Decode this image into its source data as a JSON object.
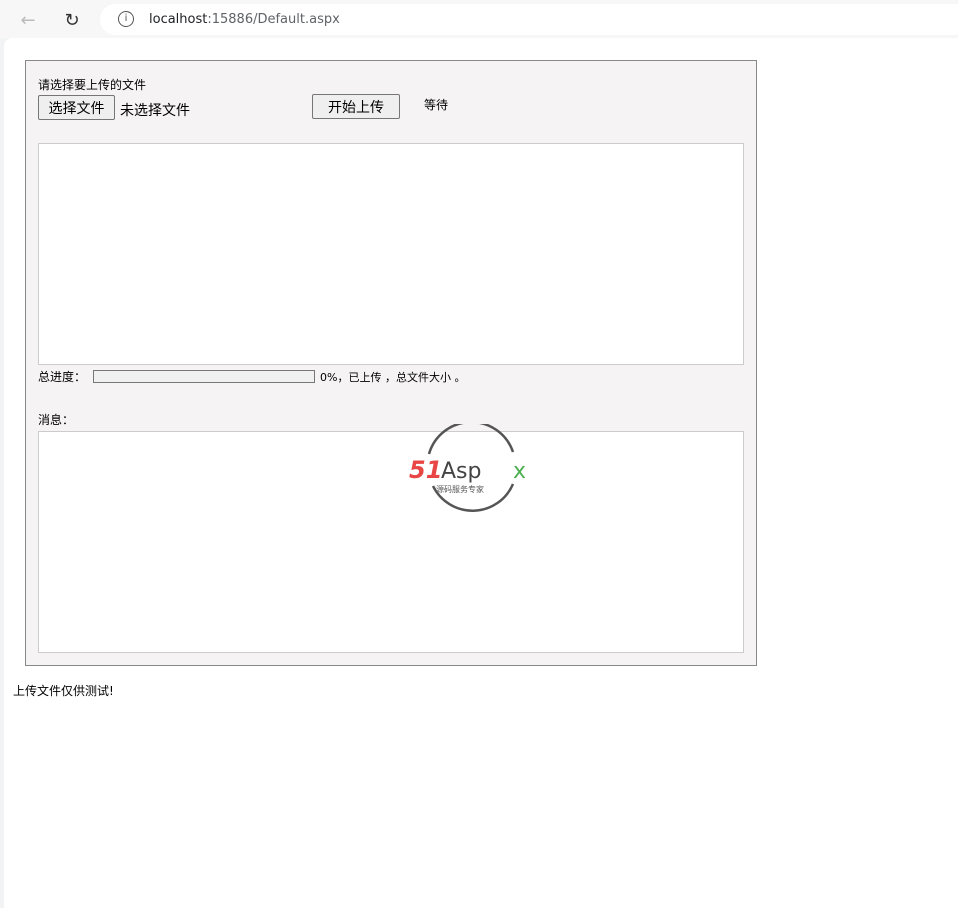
{
  "browser": {
    "url_host": "localhost",
    "url_rest": ":15886/Default.aspx"
  },
  "upload": {
    "prompt": "请选择要上传的文件",
    "choose_button": "选择文件",
    "no_file": "未选择文件",
    "start_button": "开始上传",
    "status": "等待"
  },
  "progress": {
    "label": "总进度：",
    "percent": 0,
    "text": "0%，已上传 ，总文件大小 。"
  },
  "messages": {
    "label": "消息："
  },
  "footer": "上传文件仅供测试!",
  "watermark": {
    "brand": "51Aspx",
    "tagline": "源码服务专家"
  }
}
